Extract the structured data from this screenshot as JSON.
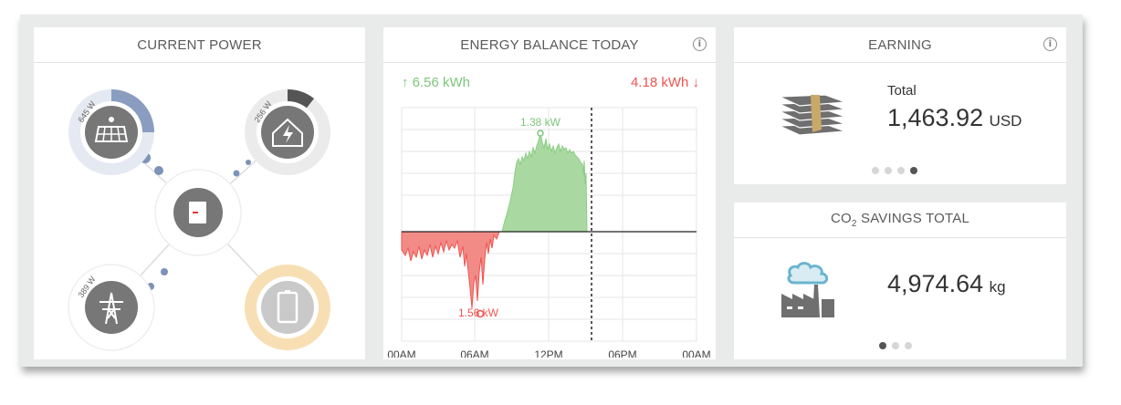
{
  "current_power": {
    "title": "CURRENT POWER",
    "solar_label": "645 W",
    "home_label": "256 W",
    "grid_label": "389 W"
  },
  "energy_balance": {
    "title": "ENERGY BALANCE TODAY",
    "produced": "↑ 6.56 kWh",
    "consumed": "4.18 kWh ↓",
    "peak_label": "1.38 kW",
    "min_label": "1.56 kW",
    "x_ticks": [
      "00AM",
      "06AM",
      "12PM",
      "06PM",
      "00AM"
    ]
  },
  "earning": {
    "title": "EARNING",
    "total_label": "Total",
    "value": "1,463.92",
    "unit": "USD"
  },
  "co2": {
    "title_prefix": "CO",
    "title_sub": "2",
    "title_suffix": " SAVINGS TOTAL",
    "value": "4,974.64",
    "unit": "kg"
  },
  "colors": {
    "positive": "#7cc67a",
    "negative": "#ef5350",
    "solar": "#7d92b8",
    "battery": "#f4d9a8",
    "icon_grey": "#777777"
  }
}
